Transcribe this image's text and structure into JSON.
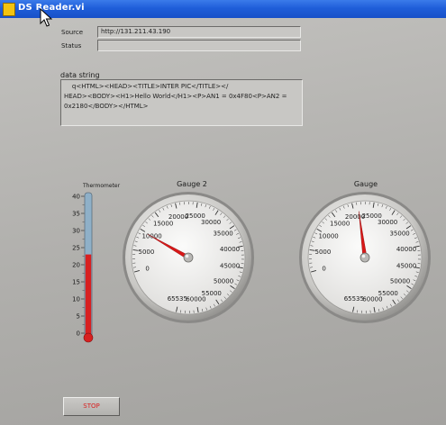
{
  "window": {
    "title": "DS Reader.vi"
  },
  "source": {
    "label": "Source",
    "value": "http://131.211.43.190"
  },
  "status": {
    "label": "Status",
    "value": ""
  },
  "data_string": {
    "label": "data string",
    "value": "    q<HTML><HEAD><TITLE>INTER PIC</TITLE></\nHEAD><BODY><H1>Hello World</H1><P>AN1 = 0x4F80<P>AN2 =\n0x2180</BODY></HTML>"
  },
  "thermometer": {
    "label": "Thermometer",
    "ticks": [
      "40",
      "35",
      "30",
      "25",
      "20",
      "15",
      "10",
      "5",
      "0"
    ],
    "max": 40,
    "value": 23,
    "fill_color": "#d82020"
  },
  "gauge2": {
    "label": "Gauge 2",
    "ticks": [
      "0",
      "5000",
      "10000",
      "15000",
      "20000",
      "25000",
      "30000",
      "35000",
      "40000",
      "45000",
      "50000",
      "55000",
      "60000",
      "65535"
    ],
    "value": 9800,
    "needle_color": "#d81818"
  },
  "gauge": {
    "label": "Gauge",
    "ticks": [
      "0",
      "5000",
      "10000",
      "15000",
      "20000",
      "25000",
      "30000",
      "35000",
      "40000",
      "45000",
      "50000",
      "55000",
      "60000",
      "65535"
    ],
    "value": 21300,
    "needle_color": "#d81818"
  },
  "stop_button": {
    "label": "STOP",
    "color": "#d92020"
  },
  "icons": {
    "window_icon": "labview-vi-icon",
    "cursor": "mouse-pointer-icon"
  }
}
